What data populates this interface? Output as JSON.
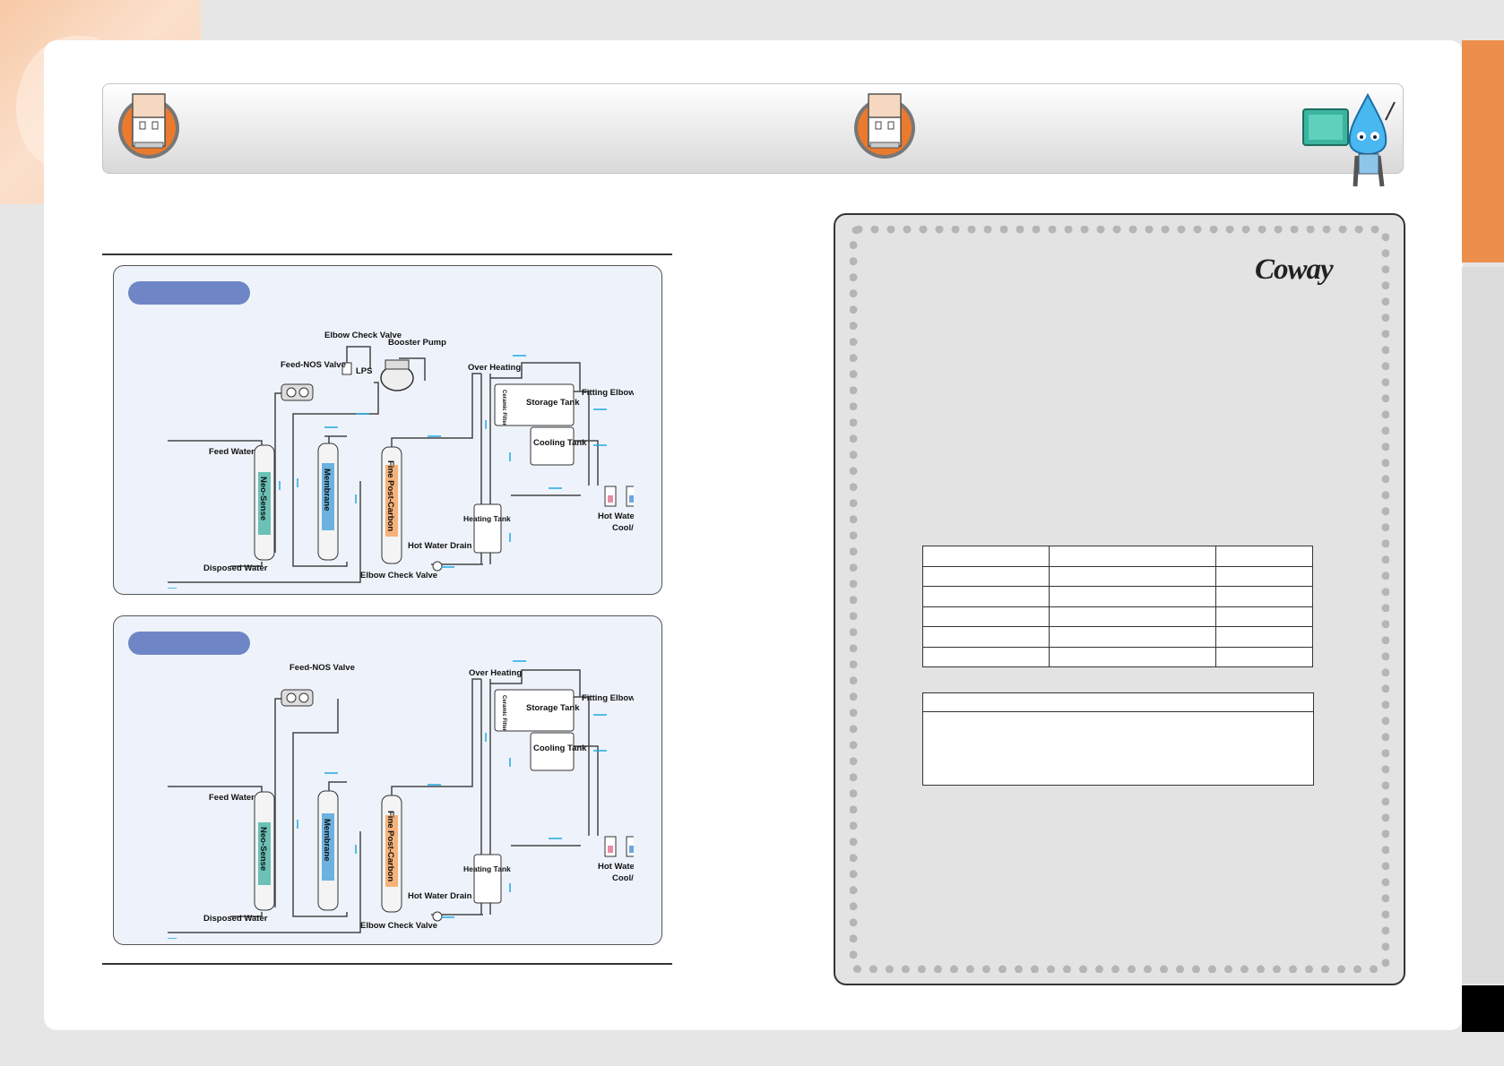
{
  "brand": {
    "name": "Coway"
  },
  "diagram_labels": {
    "elbow_check_valve": "Elbow Check Valve",
    "booster_pump": "Booster Pump",
    "feed_nos_valve": "Feed-NOS Valve",
    "lps": "LPS",
    "over_heating": "Over Heating",
    "fitting_elbow": "Fitting Elbow",
    "ceramic_filter": "Ceramic Filter",
    "storage_tank": "Storage Tank",
    "cooling_tank": "Cooling Tank",
    "feed_water": "Feed Water",
    "neo_sense": "Neo-Sense",
    "membrane": "Membrane",
    "fine_post_carbon": "Fine Post-Carbon",
    "heating_tank": "Heating Tank",
    "hot_water": "Hot Water",
    "cool_room_water": "Cool/ Room Water",
    "hot_water_drain": "Hot Water Drain",
    "disposed_water": "Disposed Water"
  },
  "colors": {
    "accent_orange": "#ec8f4c",
    "pill_blue": "#6f86c6",
    "flow_arrow": "#22a8e0",
    "panel_bg": "#eef3fb"
  },
  "icons": [
    "water-purifier-logo-icon",
    "water-drop-mascot-icon"
  ]
}
